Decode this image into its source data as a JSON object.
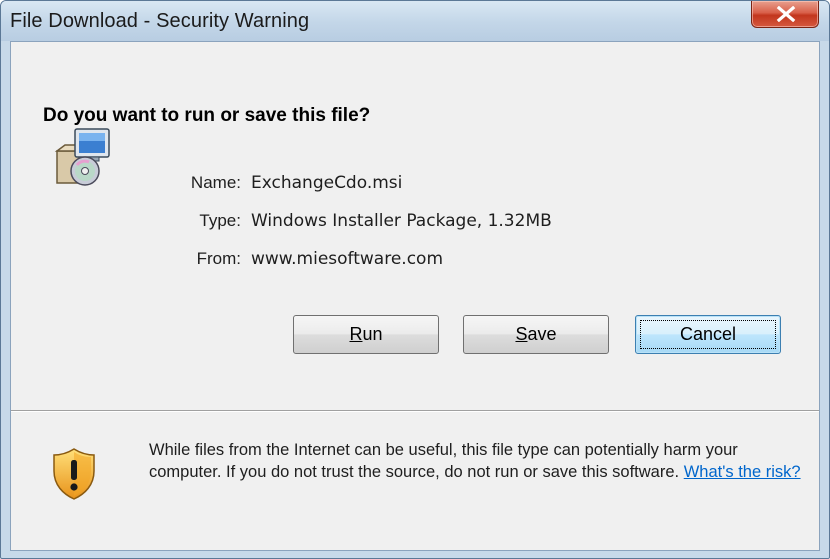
{
  "window": {
    "title": "File Download - Security Warning"
  },
  "dialog": {
    "heading": "Do you want to run or save this file?",
    "file": {
      "icon": "installer-package-icon",
      "name_label": "Name:",
      "name_value": "ExchangeCdo.msi",
      "type_label": "Type:",
      "type_value": "Windows Installer Package, 1.32MB",
      "from_label": "From:",
      "from_value": "www.miesoftware.com"
    },
    "buttons": {
      "run": {
        "pre": "",
        "mnemonic": "R",
        "post": "un"
      },
      "save": {
        "pre": "",
        "mnemonic": "S",
        "post": "ave"
      },
      "cancel": "Cancel"
    },
    "warning": {
      "icon": "shield-warning-icon",
      "text": "While files from the Internet can be useful, this file type can potentially harm your computer. If you do not trust the source, do not run or save this software.",
      "link": "What's the risk?"
    }
  },
  "colors": {
    "title_bar": "#c3d6e8",
    "close_button": "#c9442b",
    "link": "#0066cc"
  }
}
